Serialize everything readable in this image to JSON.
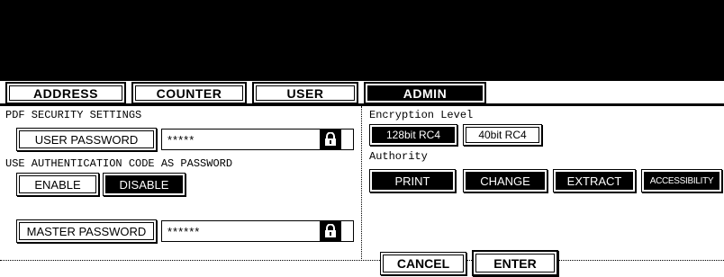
{
  "tabs": [
    {
      "label": "ADDRESS"
    },
    {
      "label": "COUNTER"
    },
    {
      "label": "USER"
    },
    {
      "label": "ADMIN"
    }
  ],
  "left": {
    "pdf_security_title": "PDF SECURITY SETTINGS",
    "user_password_label": "USER PASSWORD",
    "user_password_value": "*****",
    "auth_title": "USE AUTHENTICATION CODE AS PASSWORD",
    "enable_label": "ENABLE",
    "disable_label": "DISABLE",
    "master_password_label": "MASTER PASSWORD",
    "master_password_value": "******"
  },
  "right": {
    "encryption_title": "Encryption Level",
    "enc_128": "128bit RC4",
    "enc_40": "40bit RC4",
    "authority_title": "Authority",
    "auth_print": "PRINT",
    "auth_change": "CHANGE",
    "auth_extract": "EXTRACT",
    "auth_accessibility": "ACCESSIBILITY"
  },
  "footer": {
    "cancel_label": "CANCEL",
    "enter_label": "ENTER"
  }
}
